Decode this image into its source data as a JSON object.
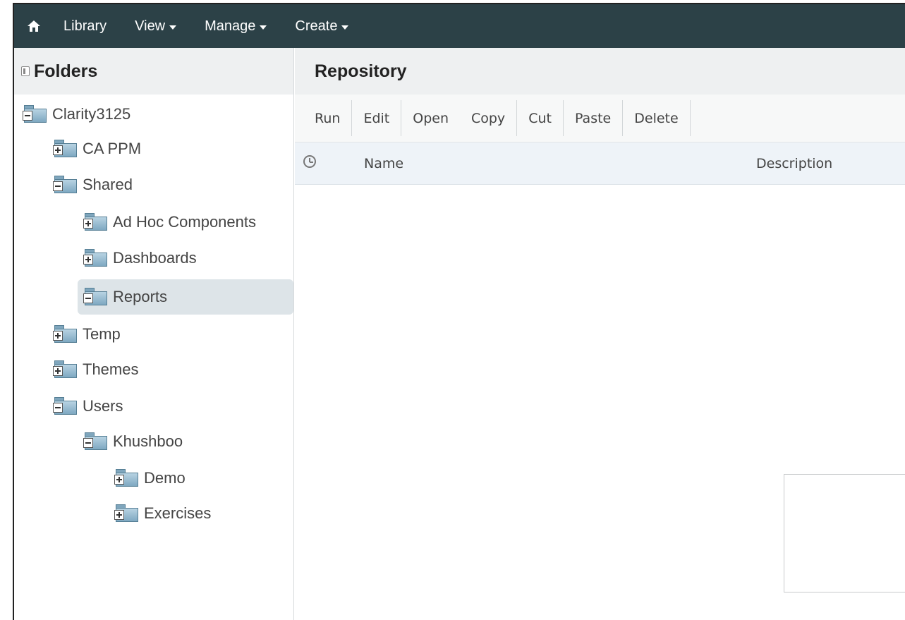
{
  "topnav": {
    "home_icon": "home-icon",
    "items": [
      {
        "label": "Library",
        "dropdown": false
      },
      {
        "label": "View",
        "dropdown": true
      },
      {
        "label": "Manage",
        "dropdown": true
      },
      {
        "label": "Create",
        "dropdown": true
      }
    ]
  },
  "sidebar": {
    "title": "Folders",
    "tree": [
      {
        "label": "Clarity3125",
        "expanded": true
      },
      {
        "label": "CA PPM",
        "expanded": false
      },
      {
        "label": "Shared",
        "expanded": true
      },
      {
        "label": "Ad Hoc Components",
        "expanded": false
      },
      {
        "label": "Dashboards",
        "expanded": false
      },
      {
        "label": "Reports",
        "expanded": true,
        "selected": true
      },
      {
        "label": "Temp",
        "expanded": false
      },
      {
        "label": "Themes",
        "expanded": false
      },
      {
        "label": "Users",
        "expanded": true
      },
      {
        "label": "Khushboo",
        "expanded": true
      },
      {
        "label": "Demo",
        "expanded": false
      },
      {
        "label": "Exercises",
        "expanded": false
      }
    ]
  },
  "main": {
    "title": "Repository",
    "toolbar": [
      "Run",
      "Edit",
      "Open",
      "Copy",
      "Cut",
      "Paste",
      "Delete"
    ],
    "columns": {
      "name": "Name",
      "description": "Description"
    }
  },
  "colors": {
    "nav_bg": "#2c4147",
    "header_bg": "#eef0f1",
    "selected_bg": "#dde4e8"
  }
}
